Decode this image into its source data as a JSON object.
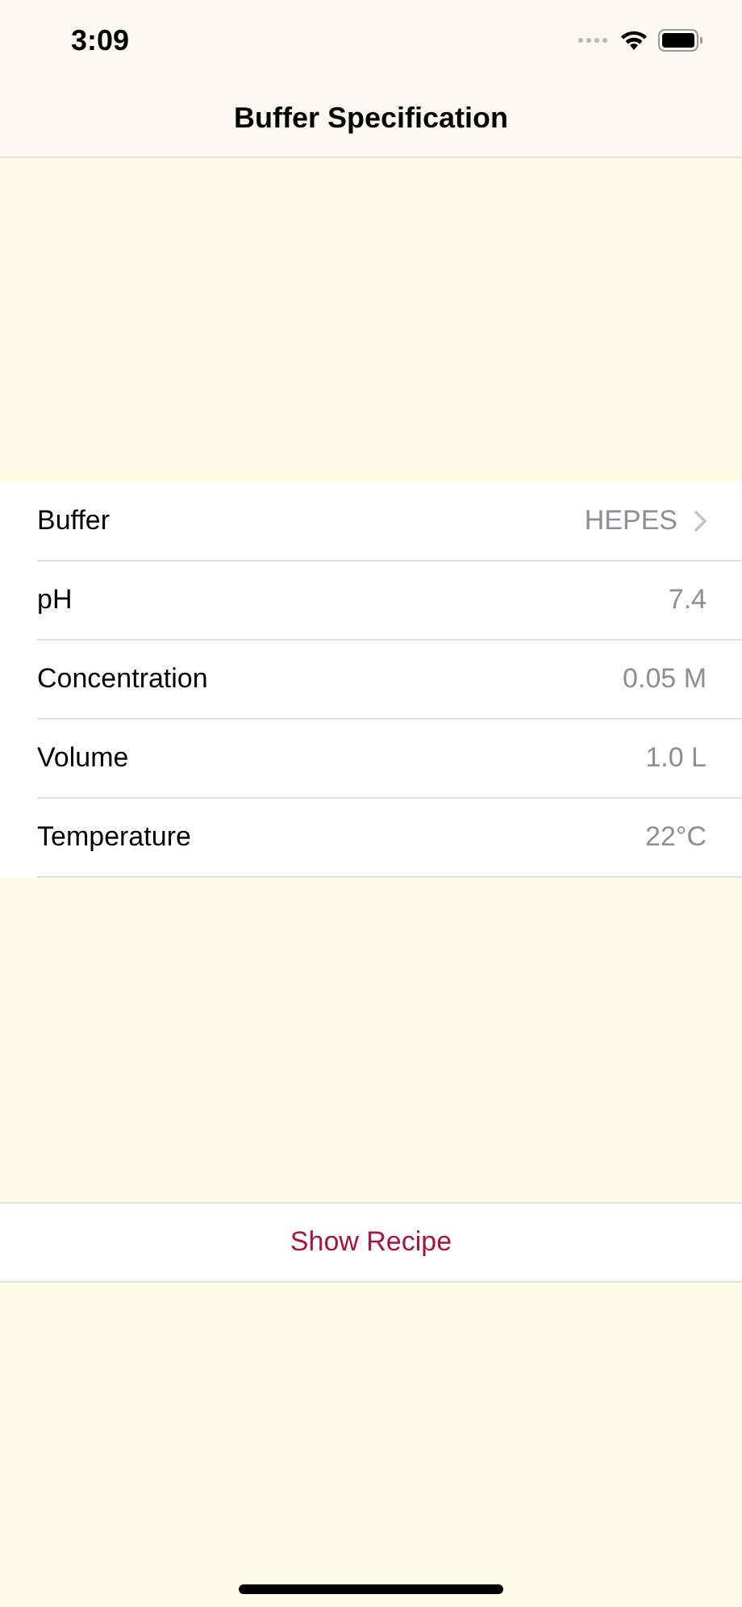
{
  "status_bar": {
    "time": "3:09"
  },
  "nav_bar": {
    "title": "Buffer Specification"
  },
  "rows": [
    {
      "label": "Buffer",
      "value": "HEPES",
      "kind": "disclosure"
    },
    {
      "label": "pH",
      "value": "7.4",
      "kind": "value"
    },
    {
      "label": "Concentration",
      "value": "0.05 M",
      "kind": "value"
    },
    {
      "label": "Volume",
      "value": "1.0 L",
      "kind": "value"
    },
    {
      "label": "Temperature",
      "value": "22°C",
      "kind": "value"
    }
  ],
  "action_button": {
    "label": "Show Recipe"
  }
}
